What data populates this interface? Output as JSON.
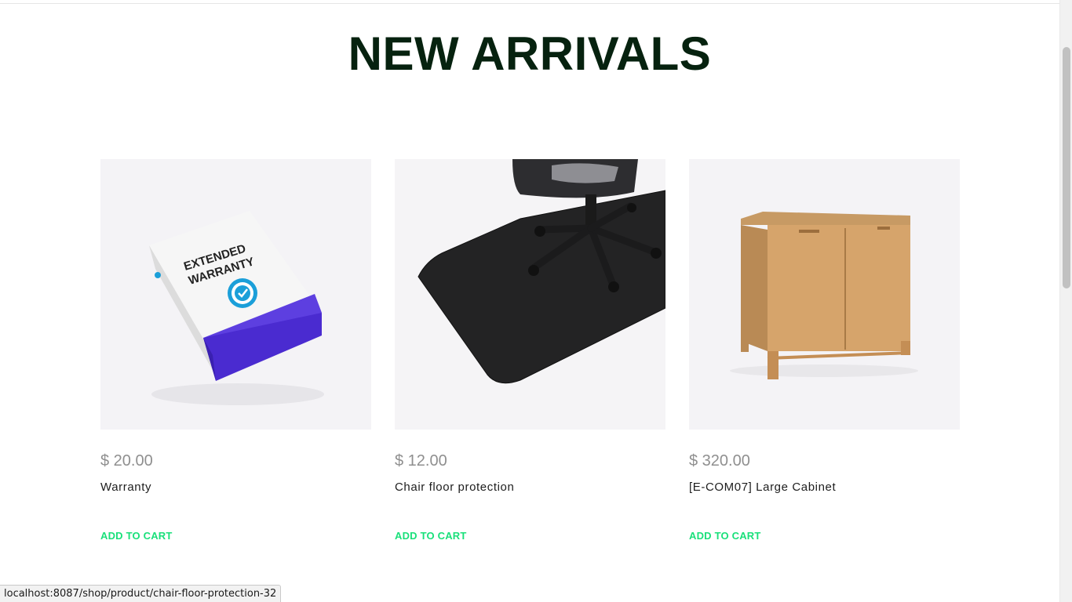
{
  "section": {
    "title": "NEW ARRIVALS"
  },
  "products": [
    {
      "price": "$ 20.00",
      "name": "Warranty",
      "add_to_cart": "ADD TO CART",
      "image_label_line1": "EXTENDED",
      "image_label_line2": "WARRANTY"
    },
    {
      "price": "$ 12.00",
      "name": "Chair floor protection",
      "add_to_cart": "ADD TO CART"
    },
    {
      "price": "$ 320.00",
      "name": "[E-COM07] Large Cabinet",
      "add_to_cart": "ADD TO CART"
    }
  ],
  "status_bar": {
    "url": "localhost:8087/shop/product/chair-floor-protection-32"
  },
  "colors": {
    "title": "#06220f",
    "accent": "#19e07a",
    "price": "#8f8f8f"
  }
}
